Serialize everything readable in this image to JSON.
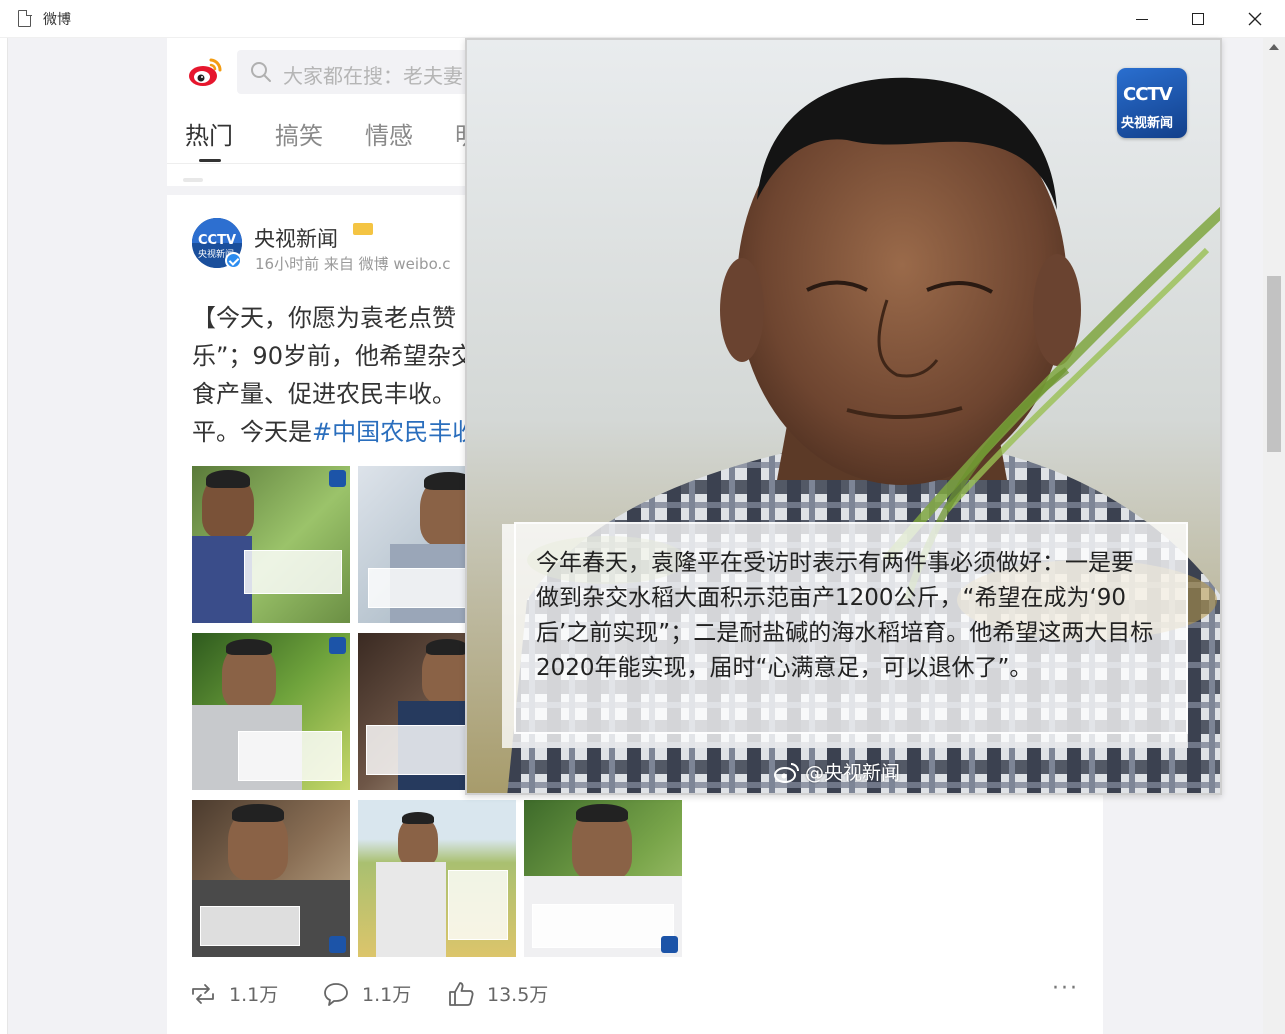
{
  "window": {
    "title": "微博"
  },
  "search": {
    "placeholder": "大家都在搜：老夫妻"
  },
  "tabs": [
    {
      "label": "热门",
      "active": true
    },
    {
      "label": "搞笑",
      "active": false
    },
    {
      "label": "情感",
      "active": false
    },
    {
      "label": "明",
      "active": false
    }
  ],
  "post": {
    "author": "央视新闻",
    "meta": "16小时前 来自 微博 weibo.c",
    "text_lines": [
      "【今天，你愿为袁老点赞",
      "乐”；90岁前，他希望杂交",
      "食产量、促进农民丰收。",
      "平。今天是"
    ],
    "hashtag": "#中国农民丰收",
    "actions": {
      "repost_count": "1.1万",
      "comment_count": "1.1万",
      "like_count": "13.5万",
      "more": "···"
    }
  },
  "overlay": {
    "logo_text": "CCTV",
    "logo_subtext": "央视新闻",
    "caption": "今年春天，袁隆平在受访时表示有两件事必须做好：一是要做到杂交水稻大面积示范亩产1200公斤，“希望在成为‘90后’之前实现”；二是耐盐碱的海水稻培育。他希望这两大目标2020年能实现，届时“心满意足，可以退休了”。",
    "watermark": "@央视新闻"
  },
  "colors": {
    "weibo_red": "#e6162d",
    "link_blue": "#2a6ebd",
    "cctv_blue": "#1c54a8"
  }
}
